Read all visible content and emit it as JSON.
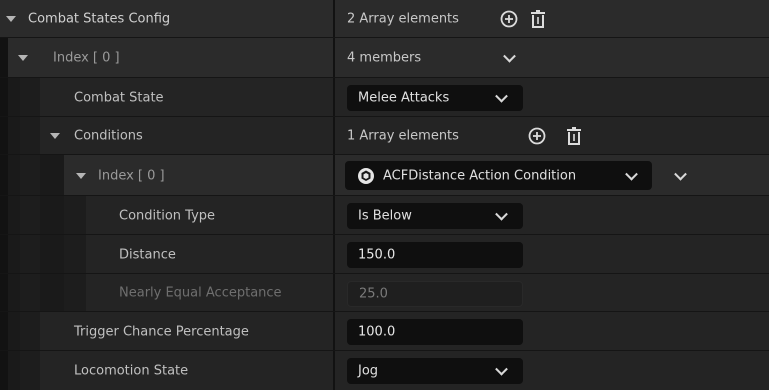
{
  "combat_states_config": {
    "label": "Combat States Config",
    "value": "2 Array elements",
    "add_icon": "plus-circle-icon",
    "delete_icon": "trash-icon"
  },
  "index0": {
    "label": "Index [ 0 ]",
    "value": "4 members"
  },
  "combat_state": {
    "label": "Combat State",
    "value": "Melee Attacks"
  },
  "conditions": {
    "label": "Conditions",
    "value": "1 Array elements"
  },
  "cond_index0": {
    "label": "Index [ 0 ]",
    "value": "ACFDistance Action Condition",
    "class_icon": "blueprint-class-icon"
  },
  "condition_type": {
    "label": "Condition Type",
    "value": "Is Below"
  },
  "distance": {
    "label": "Distance",
    "value": "150.0"
  },
  "nearly_equal": {
    "label": "Nearly Equal Acceptance",
    "value": "25.0"
  },
  "trigger_chance": {
    "label": "Trigger Chance Percentage",
    "value": "100.0"
  },
  "locomotion_state": {
    "label": "Locomotion State",
    "value": "Jog"
  }
}
